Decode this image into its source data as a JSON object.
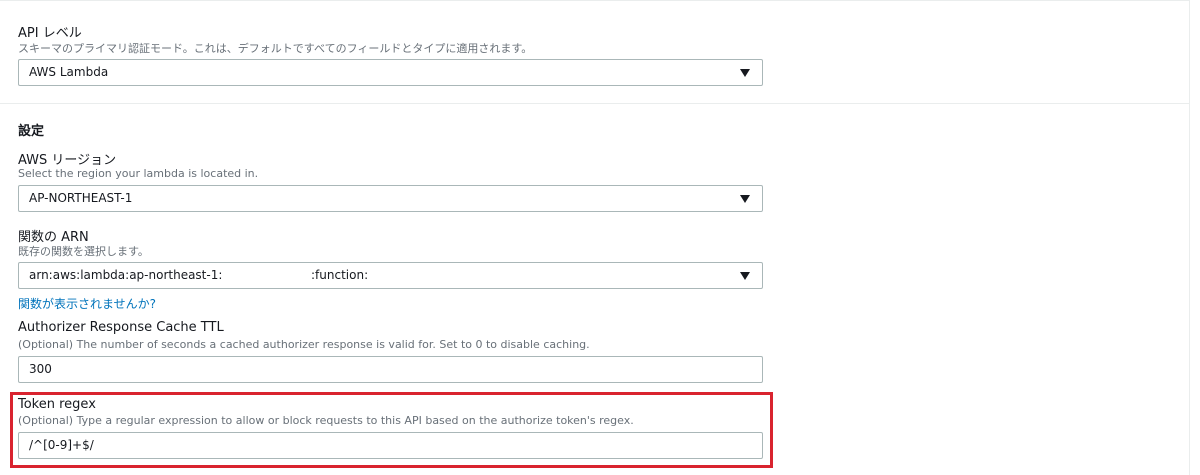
{
  "api_level": {
    "label": "API レベル",
    "description": "スキーマのプライマリ認証モード。これは、デフォルトですべてのフィールドとタイプに適用されます。",
    "selected": "AWS Lambda"
  },
  "settings": {
    "title": "設定",
    "region": {
      "label": "AWS リージョン",
      "description": "Select the region your lambda is located in.",
      "selected": "AP-NORTHEAST-1"
    },
    "function_arn": {
      "label": "関数の ARN",
      "description": "既存の関数を選択します。",
      "value_prefix": "arn:aws:lambda:ap-northeast-1:",
      "value_suffix": ":function:",
      "help_link": "関数が表示されませんか?"
    },
    "cache_ttl": {
      "label": "Authorizer Response Cache TTL",
      "description": "(Optional) The number of seconds a cached authorizer response is valid for. Set to 0 to disable caching.",
      "value": "300"
    },
    "token_regex": {
      "label": "Token regex",
      "description": "(Optional) Type a regular expression to allow or block requests to this API based on the authorize token's regex.",
      "value": "/^[0-9]+$/"
    }
  },
  "colors": {
    "link": "#0073bb",
    "highlight": "#d9232f",
    "border": "#aab7b8",
    "muted_text": "#687078"
  }
}
